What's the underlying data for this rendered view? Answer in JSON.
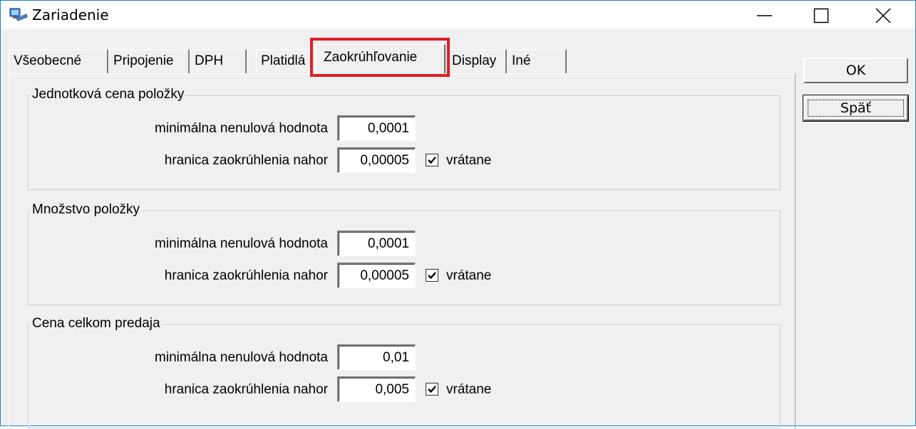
{
  "window": {
    "title": "Zariadenie",
    "icon": "monitor-icon",
    "controls": {
      "minimize": "minimize-icon",
      "maximize": "maximize-icon",
      "close": "close-icon"
    }
  },
  "tabs": [
    {
      "label": "Všeobecné",
      "active": false
    },
    {
      "label": "Pripojenie",
      "active": false
    },
    {
      "label": "DPH",
      "active": false
    },
    {
      "label": "Platidlá",
      "active": false
    },
    {
      "label": "Zaokrúhľovanie",
      "active": true
    },
    {
      "label": "Display",
      "active": false
    },
    {
      "label": "Iné",
      "active": false
    }
  ],
  "highlight_color": "#e31c23",
  "groups": [
    {
      "title": "Jednotková cena položky",
      "min_label": "minimálna nenulová hodnota",
      "min_value": "0,0001",
      "round_label": "hranica zaokrúhlenia nahor",
      "round_value": "0,00005",
      "inclusive_label": "vrátane",
      "inclusive_checked": true
    },
    {
      "title": "Množstvo položky",
      "min_label": "minimálna nenulová hodnota",
      "min_value": "0,0001",
      "round_label": "hranica zaokrúhlenia nahor",
      "round_value": "0,00005",
      "inclusive_label": "vrátane",
      "inclusive_checked": true
    },
    {
      "title": "Cena celkom predaja",
      "min_label": "minimálna nenulová hodnota",
      "min_value": "0,01",
      "round_label": "hranica zaokrúhlenia nahor",
      "round_value": "0,005",
      "inclusive_label": "vrátane",
      "inclusive_checked": true
    }
  ],
  "buttons": {
    "ok": "OK",
    "back": "Späť"
  }
}
